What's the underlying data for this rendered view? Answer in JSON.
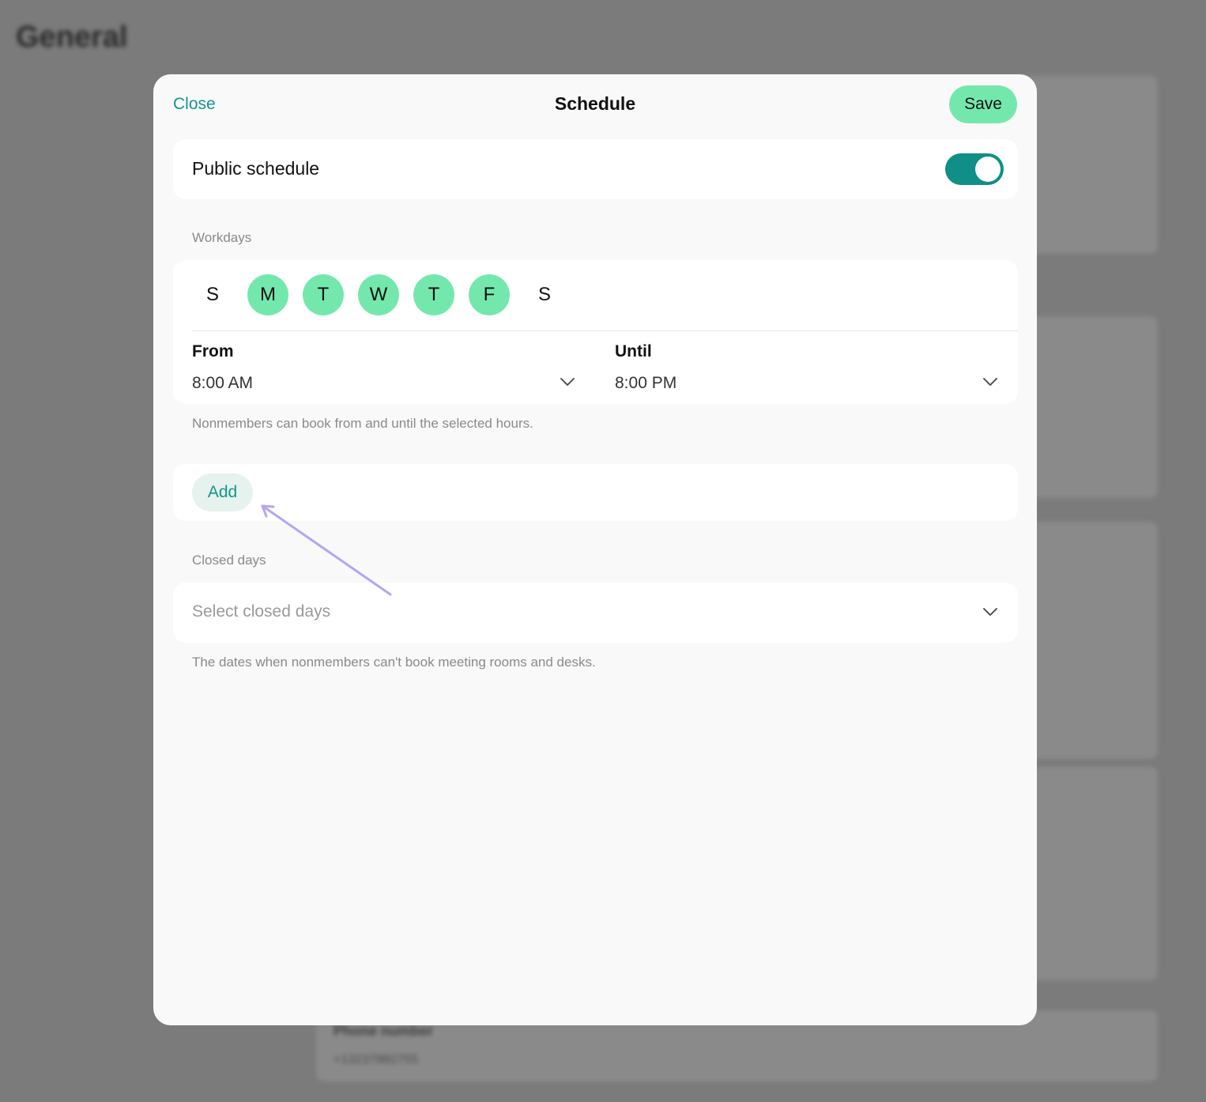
{
  "background": {
    "title": "General",
    "phone_label": "Phone number",
    "phone_value": "+13237882755"
  },
  "modal": {
    "close_label": "Close",
    "title": "Schedule",
    "save_label": "Save"
  },
  "public_schedule": {
    "label": "Public schedule",
    "enabled": true
  },
  "workdays": {
    "section_label": "Workdays",
    "days": [
      {
        "letter": "S",
        "selected": false
      },
      {
        "letter": "M",
        "selected": true
      },
      {
        "letter": "T",
        "selected": true
      },
      {
        "letter": "W",
        "selected": true
      },
      {
        "letter": "T",
        "selected": true
      },
      {
        "letter": "F",
        "selected": true
      },
      {
        "letter": "S",
        "selected": false
      }
    ],
    "from_label": "From",
    "from_value": "8:00 AM",
    "until_label": "Until",
    "until_value": "8:00 PM",
    "helper": "Nonmembers can book from and until the selected hours."
  },
  "add_label": "Add",
  "closed_days": {
    "section_label": "Closed days",
    "placeholder": "Select closed days",
    "helper": "The dates when nonmembers can't book meeting rooms and desks."
  },
  "colors": {
    "accent": "#15968a",
    "toggle_on": "#0f8f86",
    "day_selected": "#74e8ac",
    "save_bg": "#74e8ac",
    "annotation_arrow": "#b3a6f2"
  }
}
